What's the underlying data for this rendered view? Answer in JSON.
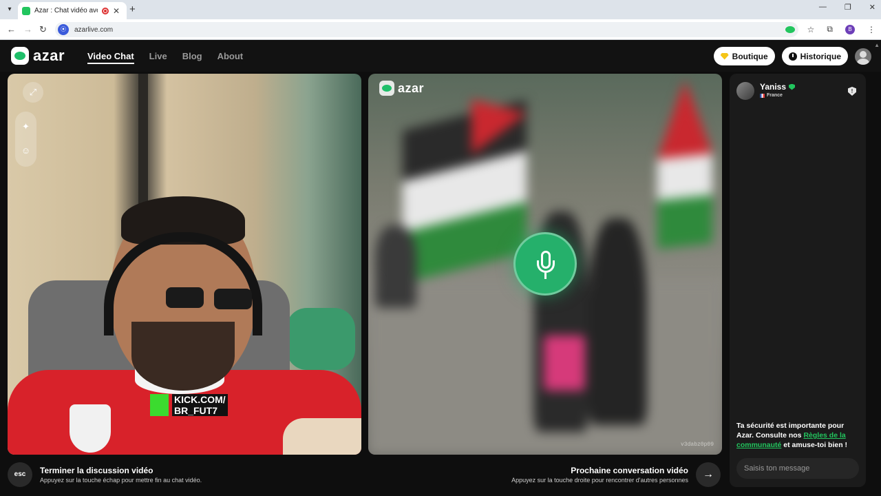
{
  "browser": {
    "tab_title": "Azar : Chat vidéo avec de n",
    "url": "azarlive.com",
    "profile_initial": "B"
  },
  "header": {
    "logo_text": "azar",
    "nav": [
      {
        "label": "Video Chat",
        "active": true
      },
      {
        "label": "Live",
        "active": false
      },
      {
        "label": "Blog",
        "active": false
      },
      {
        "label": "About",
        "active": false
      }
    ],
    "shop_label": "Boutique",
    "history_label": "Historique"
  },
  "left_video": {
    "overlay_line1": "KICK.COM/",
    "overlay_line2": "BR_FUT7"
  },
  "right_video": {
    "logo_text": "azar",
    "session_id": "v3dabz0p09"
  },
  "controls": {
    "esc_label": "esc",
    "end_title": "Terminer la discussion vidéo",
    "end_subtitle": "Appuyez sur la touche échap pour mettre fin au chat vidéo.",
    "next_title": "Prochaine conversation vidéo",
    "next_subtitle": "Appuyez sur la touche droite pour rencontrer d'autres personnes"
  },
  "chat": {
    "partner_name": "Yaniss",
    "partner_country": "France",
    "safety_text_1": "Ta sécurité est importante pour Azar. Consulte nos ",
    "safety_link": "Règles de la communauté",
    "safety_text_2": " et amuse-toi bien !",
    "message_placeholder": "Saisis ton message"
  },
  "colors": {
    "brand_green": "#22c55e",
    "header_bg": "#121212",
    "panel_bg": "#1b1b1b"
  }
}
